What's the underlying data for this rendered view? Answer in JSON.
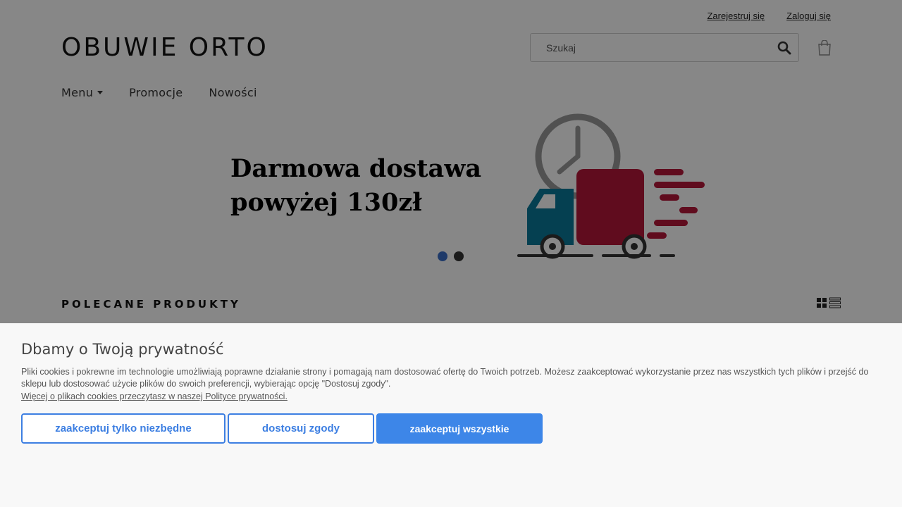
{
  "header": {
    "register_link": "Zarejestruj się",
    "login_link": "Zaloguj się",
    "logo": "OBUWIE ORTO",
    "search_placeholder": "Szukaj"
  },
  "nav": {
    "items": [
      {
        "label": "Menu",
        "has_dropdown": true
      },
      {
        "label": "Promocje"
      },
      {
        "label": "Nowości"
      }
    ]
  },
  "banner": {
    "line1": "Darmowa dostawa",
    "line2": "powyżej 130zł",
    "slides_total": 2,
    "active_slide": 1
  },
  "products": {
    "section_title": "POLECANE PRODUKTY"
  },
  "cookie": {
    "title": "Dbamy o Twoją prywatność",
    "text": "Pliki cookies i pokrewne im technologie umożliwiają poprawne działanie strony i pomagają nam dostosować ofertę do Twoich potrzeb. Możesz zaakceptować wykorzystanie przez nas wszystkich tych plików i przejść do sklepu lub dostosować użycie plików do swoich preferencji, wybierając opcję \"Dostosuj zgody\".",
    "policy_link": "Więcej o plikach cookies przeczytasz w naszej Polityce prywatności.",
    "btn_necessary": "zaakceptuj tylko niezbędne",
    "btn_customize": "dostosuj zgody",
    "btn_accept_all": "zaakceptuj wszystkie"
  },
  "colors": {
    "accent": "#3d7fe2",
    "truck_red": "#b5173a",
    "truck_blue": "#0b7a9a",
    "active_dot": "#3b6fc7"
  },
  "icons": {
    "search": "search-icon",
    "cart": "shopping-bag-icon",
    "grid_view": "grid-view-icon",
    "list_view": "list-view-icon",
    "caret": "caret-down-icon"
  }
}
